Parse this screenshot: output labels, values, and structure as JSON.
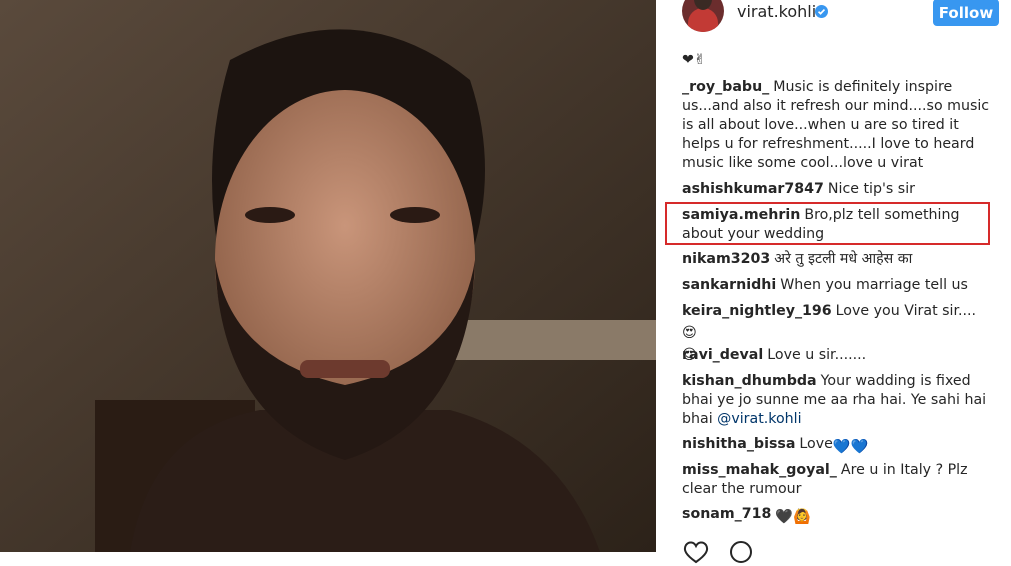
{
  "video": {
    "description_alt": ""
  },
  "header": {
    "username": "virat.kohli",
    "follow_label": "Follow"
  },
  "comments": [
    {
      "id": "c0",
      "user": "",
      "text": "",
      "emojis": "❤✌"
    },
    {
      "id": "c1",
      "user": "_roy_babu_",
      "text": "Music is definitely inspire us...and also it refresh our mind....so music is all about love...when u are so tired it helps u for refreshment.....I love to heard music like some cool...love u virat"
    },
    {
      "id": "c2",
      "user": "ashishkumar7847",
      "text": "Nice tip's sir"
    },
    {
      "id": "c3",
      "user": "samiya.mehrin",
      "text": "Bro,plz tell something about your wedding"
    },
    {
      "id": "c4",
      "user": "nikam3203",
      "text": "अरे तु इटली मधे आहेस का"
    },
    {
      "id": "c5",
      "user": "sankarnidhi",
      "text": "When you marriage tell us"
    },
    {
      "id": "c6",
      "user": "keira_nightley_196",
      "text": "Love you Virat sir....",
      "emojis": "😍 😍"
    },
    {
      "id": "c7",
      "user": "ravi_deval",
      "text": "Love u sir......."
    },
    {
      "id": "c8",
      "user": "kishan_dhumbda",
      "text": "Your wadding is fixed bhai ye jo sunne me aa rha hai. Ye sahi hai bhai",
      "mention": "@virat.kohli"
    },
    {
      "id": "c9",
      "user": "nishitha_bissa",
      "text": "Love",
      "emojis": "💙💙"
    },
    {
      "id": "c10",
      "user": "miss_mahak_goyal_",
      "text": "Are u in Italy ? Plz clear the rumour"
    },
    {
      "id": "c11",
      "user": "sonam_718",
      "text": "",
      "emojis": "🖤🙆"
    }
  ],
  "colors": {
    "follow": "#3897f0",
    "highlight": "#d62a2a",
    "text": "#262626",
    "mention": "#003569"
  }
}
